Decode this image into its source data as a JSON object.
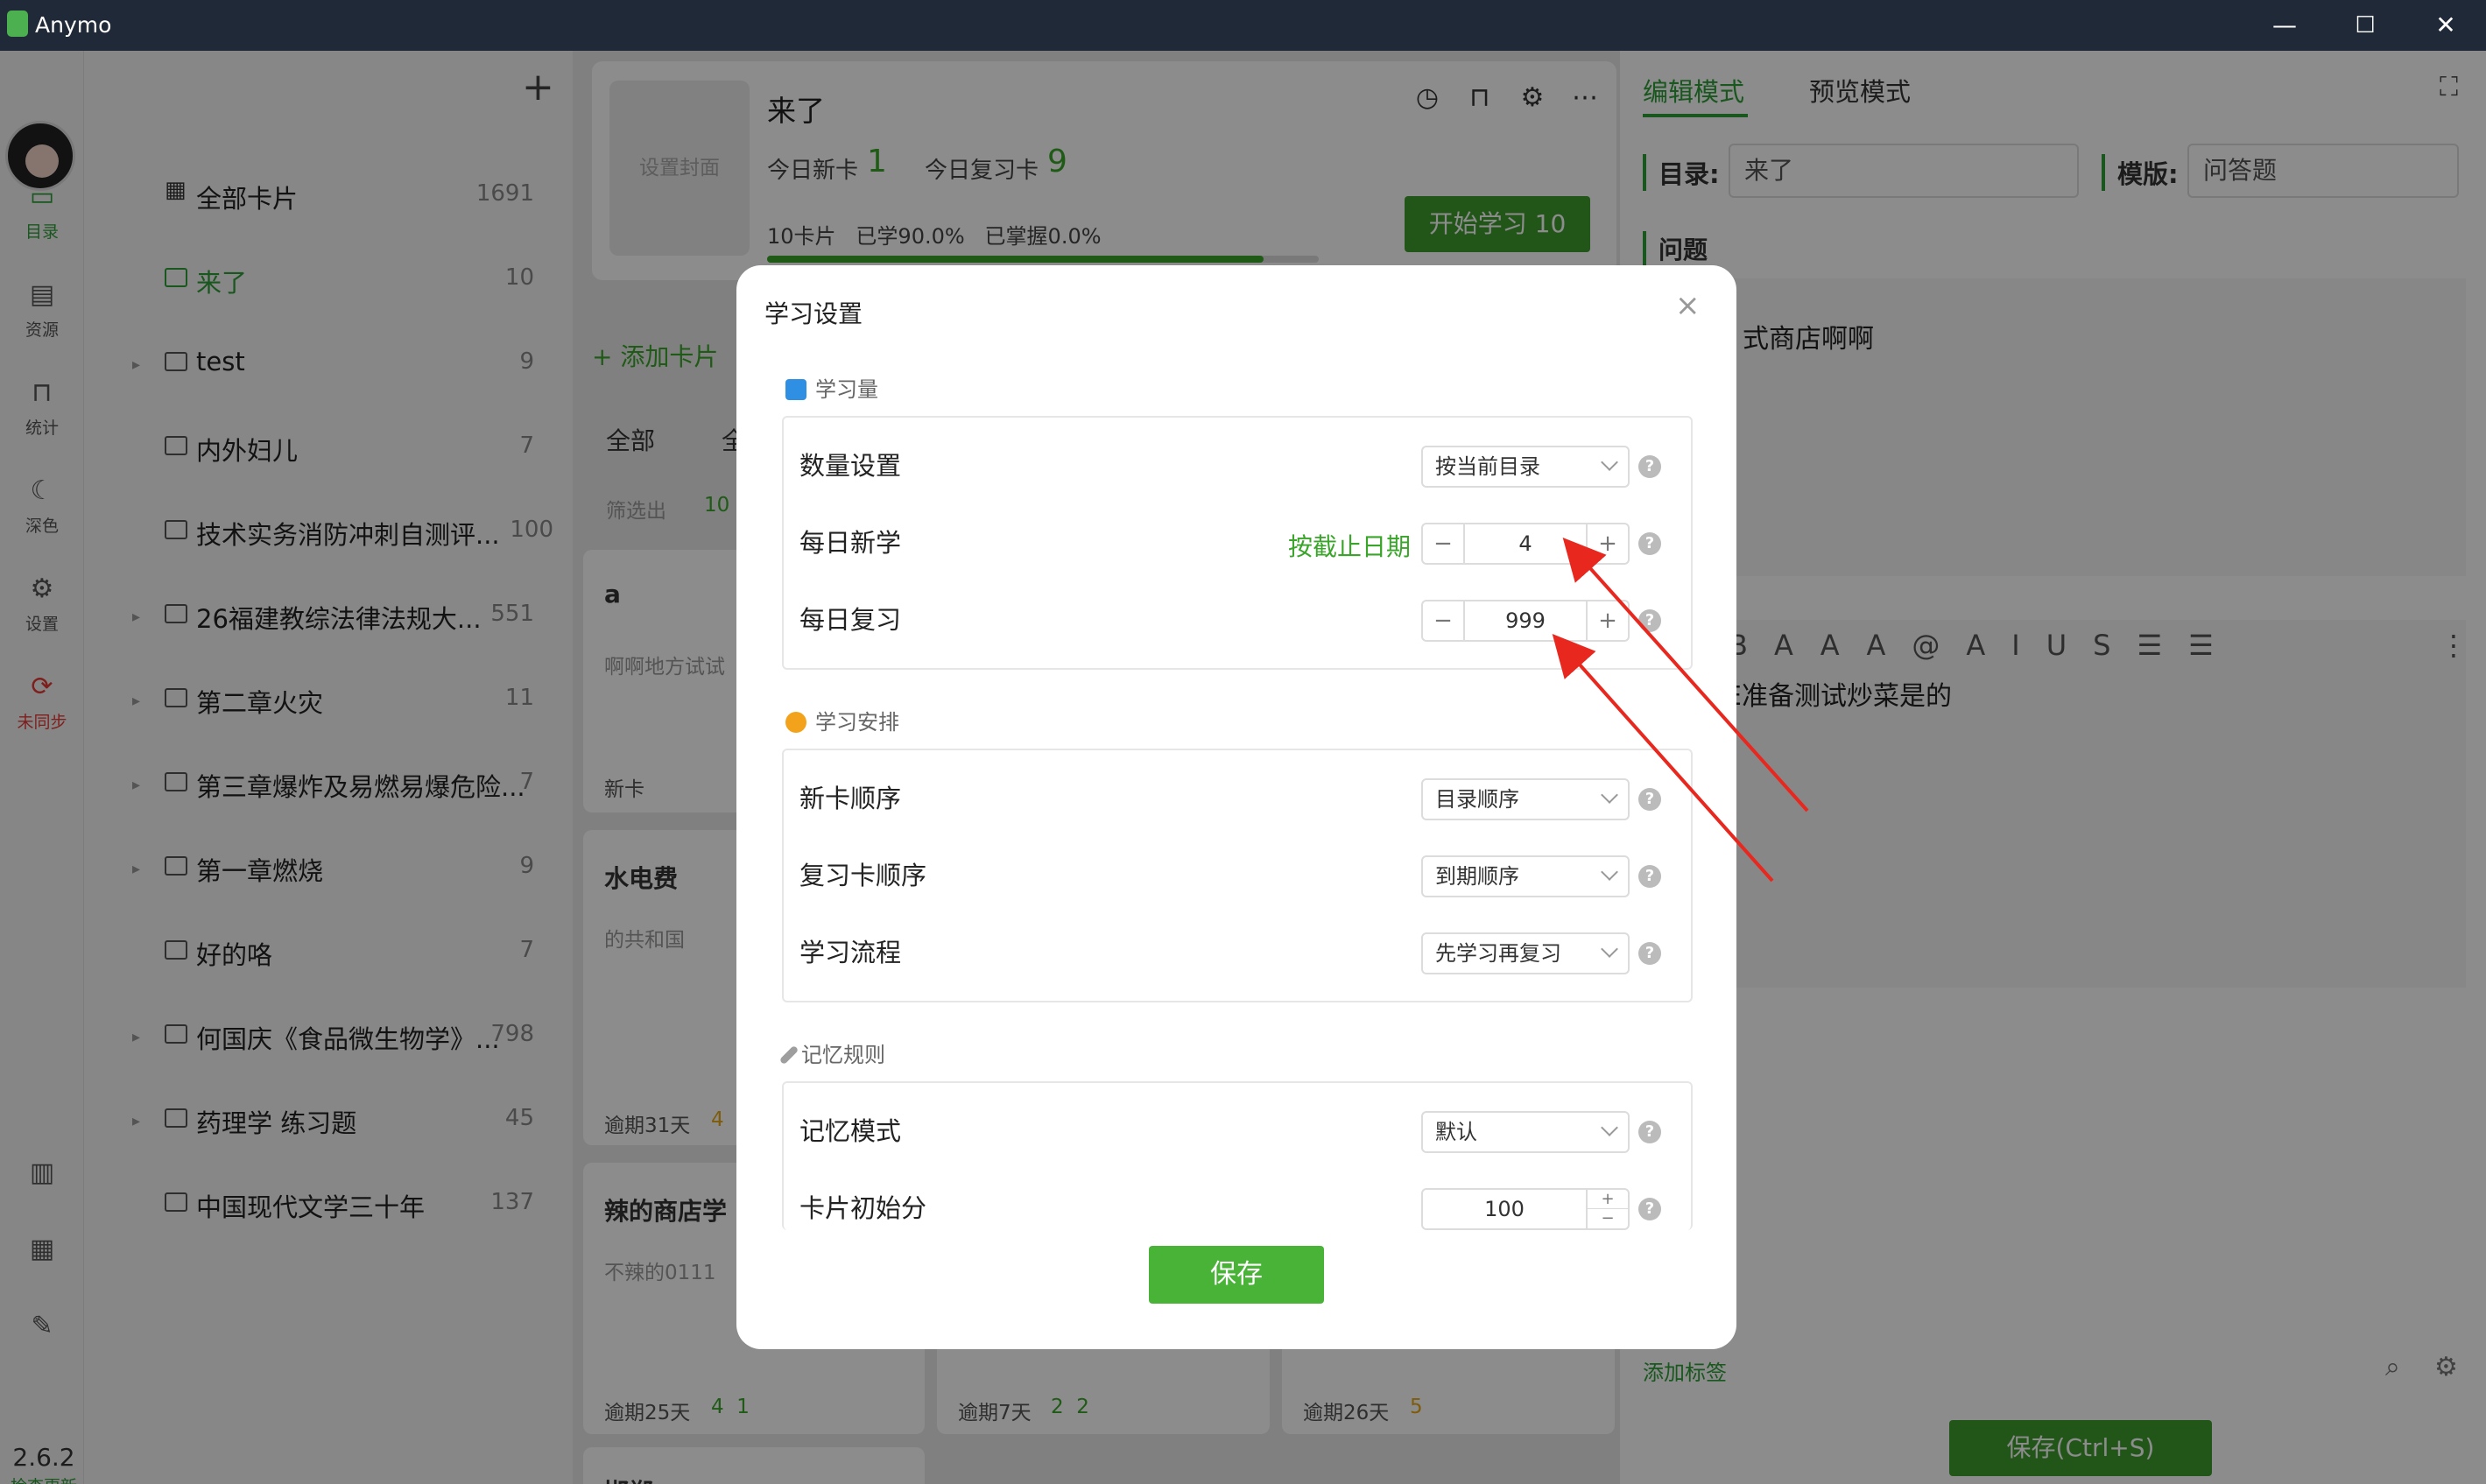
{
  "app": {
    "title": "Anymo",
    "version": "2.6.2",
    "check_update": "检查更新"
  },
  "window": {
    "minimize": "—",
    "maximize": "☐",
    "close": "✕"
  },
  "sidebar": {
    "items": [
      {
        "label": "目录",
        "icon": "monitor-icon"
      },
      {
        "label": "资源",
        "icon": "resource-icon"
      },
      {
        "label": "统计",
        "icon": "stats-icon"
      },
      {
        "label": "深色",
        "icon": "moon-icon"
      },
      {
        "label": "设置",
        "icon": "gear-icon"
      },
      {
        "label": "未同步",
        "icon": "sync-icon"
      }
    ],
    "colors": {
      "active": "#2e9e3a",
      "unsynced": "#e53935"
    }
  },
  "directory": {
    "add": "+",
    "items": [
      {
        "name": "全部卡片",
        "count": "1691"
      },
      {
        "name": "来了",
        "count": "10"
      },
      {
        "name": "test",
        "count": "9"
      },
      {
        "name": "内外妇儿",
        "count": "7"
      },
      {
        "name": "技术实务消防冲刺自测评...",
        "count": "100"
      },
      {
        "name": "26福建教综法律法规大...",
        "count": "551"
      },
      {
        "name": "第二章火灾",
        "count": "11"
      },
      {
        "name": "第三章爆炸及易燃易爆危险...",
        "count": "7"
      },
      {
        "name": "第一章燃烧",
        "count": "9"
      },
      {
        "name": "好的咯",
        "count": "7"
      },
      {
        "name": "何国庆《食品微生物学》...",
        "count": "798"
      },
      {
        "name": "药理学 练习题",
        "count": "45"
      },
      {
        "name": "中国现代文学三十年",
        "count": "137"
      }
    ]
  },
  "deck": {
    "cover": "设置封面",
    "name": "来了",
    "new_label": "今日新卡",
    "new_count": "1",
    "review_label": "今日复习卡",
    "review_count": "9",
    "stats": "10卡片   已学90.0%   已掌握0.0%",
    "progress": 0.9,
    "start_button": "开始学习 10"
  },
  "cards_toolbar": {
    "add_card": "+ 添加卡片",
    "filter_all": "全部",
    "filter_2": "全",
    "filtered": "筛选出",
    "filtered_count": "10"
  },
  "cards": [
    {
      "title": "a",
      "body": "啊啊地方试试",
      "footer": "新卡",
      "footer_num": ""
    },
    {
      "title": "水电费",
      "body": "的共和国",
      "footer": "逾期31天",
      "footer_num": "4"
    },
    {
      "title": "辣的商店学",
      "body": "不辣的0111",
      "footer": "逾期25天",
      "footer_num": "4  1"
    },
    {
      "title": "",
      "body": "",
      "footer": "逾期7天",
      "footer_num": "2  2"
    },
    {
      "title": "",
      "body": "",
      "footer": "逾期26天",
      "footer_num": "5"
    },
    {
      "title": "邯郸",
      "body": "",
      "footer": "",
      "footer_num": ""
    }
  ],
  "editor": {
    "tab_edit": "编辑模式",
    "tab_preview": "预览模式",
    "dir_label": "目录:",
    "dir_value": "来了",
    "template_label": "模版:",
    "template_value": "问答题",
    "question_label": "问题",
    "question_text": "式商店啊啊",
    "answer_text": "E准备测试炒菜是的",
    "add_tag": "添加标签",
    "save": "保存(Ctrl+S)"
  },
  "dialog": {
    "title": "学习设置",
    "close": "×",
    "sections": [
      {
        "title": "学习量",
        "rows": [
          {
            "label": "数量设置",
            "type": "select",
            "value": "按当前目录"
          },
          {
            "label": "每日新学",
            "type": "stepper",
            "value": "4",
            "extra": "按截止日期"
          },
          {
            "label": "每日复习",
            "type": "stepper",
            "value": "999"
          }
        ]
      },
      {
        "title": "学习安排",
        "rows": [
          {
            "label": "新卡顺序",
            "type": "select",
            "value": "目录顺序"
          },
          {
            "label": "复习卡顺序",
            "type": "select",
            "value": "到期顺序"
          },
          {
            "label": "学习流程",
            "type": "select",
            "value": "先学习再复习"
          }
        ]
      },
      {
        "title": "记忆规则",
        "rows": [
          {
            "label": "记忆模式",
            "type": "select",
            "value": "默认"
          },
          {
            "label": "卡片初始分",
            "type": "stepper",
            "value": "100"
          }
        ]
      }
    ],
    "help": "?",
    "save": "保存",
    "accent": "#49b338",
    "arrow_color": "#e8281f"
  }
}
